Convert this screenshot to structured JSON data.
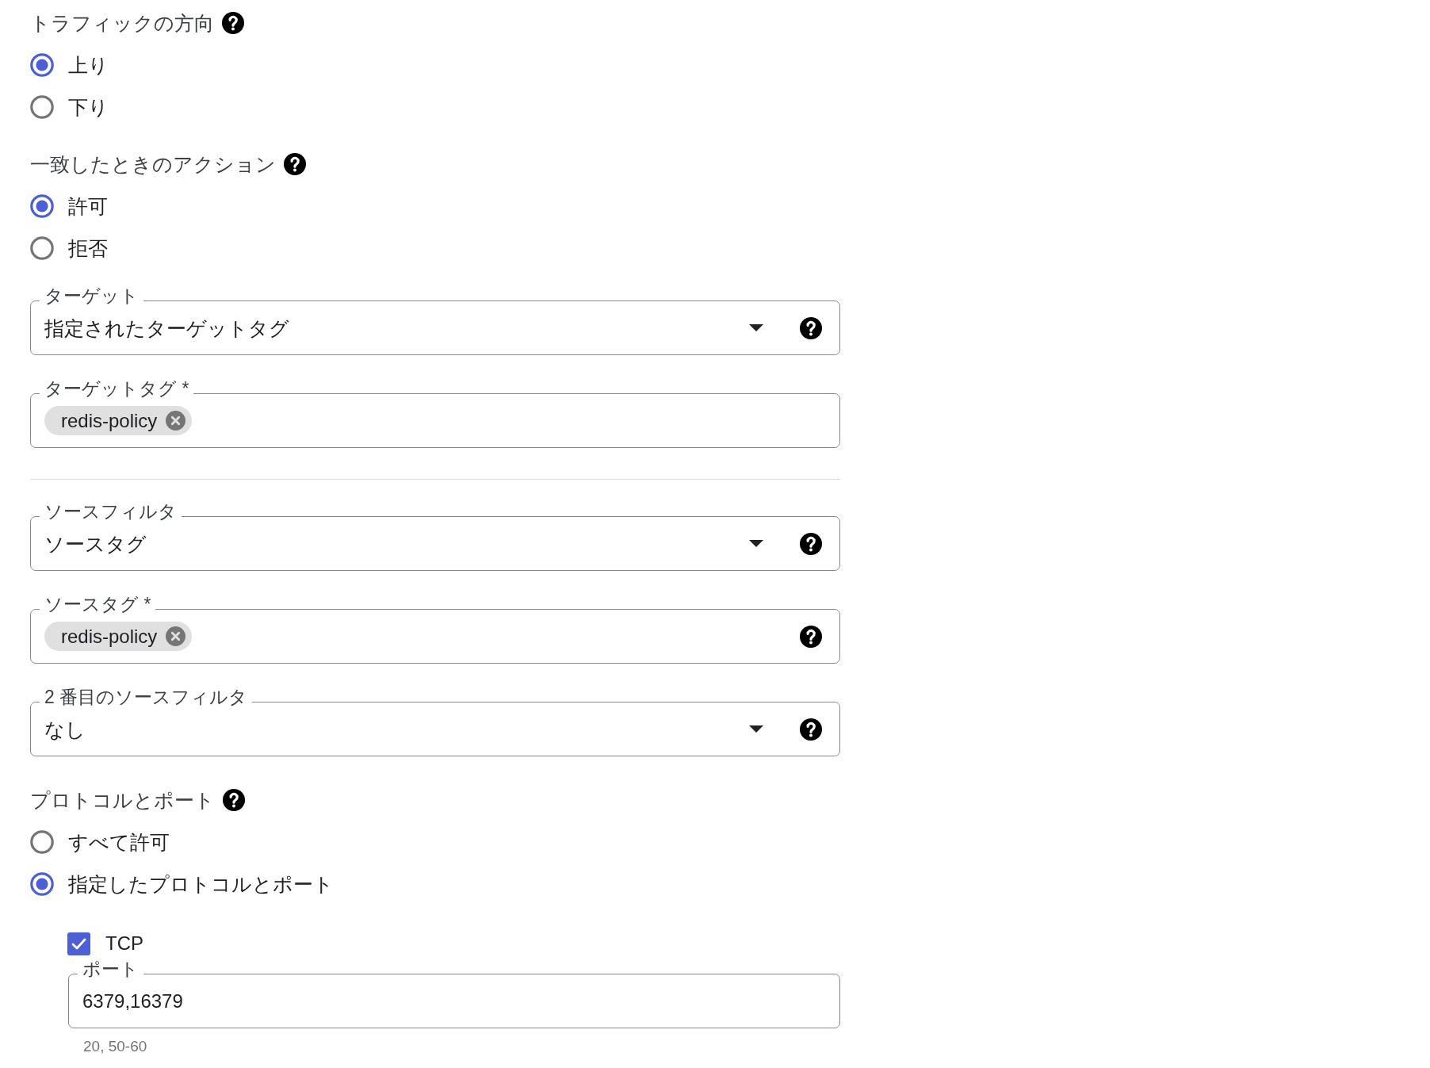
{
  "sections": [
    {
      "kind": "radio_group",
      "title": "トラフィックの方向",
      "help": true,
      "options": [
        {
          "label": "上り",
          "selected": true
        },
        {
          "label": "下り",
          "selected": false
        }
      ]
    },
    {
      "kind": "radio_group",
      "title": "一致したときのアクション",
      "help": true,
      "options": [
        {
          "label": "許可",
          "selected": true
        },
        {
          "label": "拒否",
          "selected": false
        }
      ]
    },
    {
      "kind": "select",
      "label": "ターゲット",
      "value": "指定されたターゲットタグ",
      "help": true
    },
    {
      "kind": "tags",
      "label": "ターゲットタグ *",
      "tags": [
        "redis-policy"
      ]
    },
    {
      "kind": "divider"
    },
    {
      "kind": "select",
      "label": "ソースフィルタ",
      "value": "ソースタグ",
      "help": true
    },
    {
      "kind": "tags",
      "label": "ソースタグ *",
      "tags": [
        "redis-policy"
      ],
      "help": true
    },
    {
      "kind": "select",
      "label": "2 番目のソースフィルタ",
      "value": "なし",
      "help": true
    },
    {
      "kind": "radio_group",
      "title": "プロトコルとポート",
      "help": true,
      "options": [
        {
          "label": "すべて許可",
          "selected": false
        },
        {
          "label": "指定したプロトコルとポート",
          "selected": true
        }
      ],
      "protocols": [
        {
          "label": "TCP",
          "checked": true,
          "port_field": {
            "label": "ポート",
            "value": "6379,16379",
            "hint": "20, 50-60"
          }
        }
      ]
    }
  ]
}
